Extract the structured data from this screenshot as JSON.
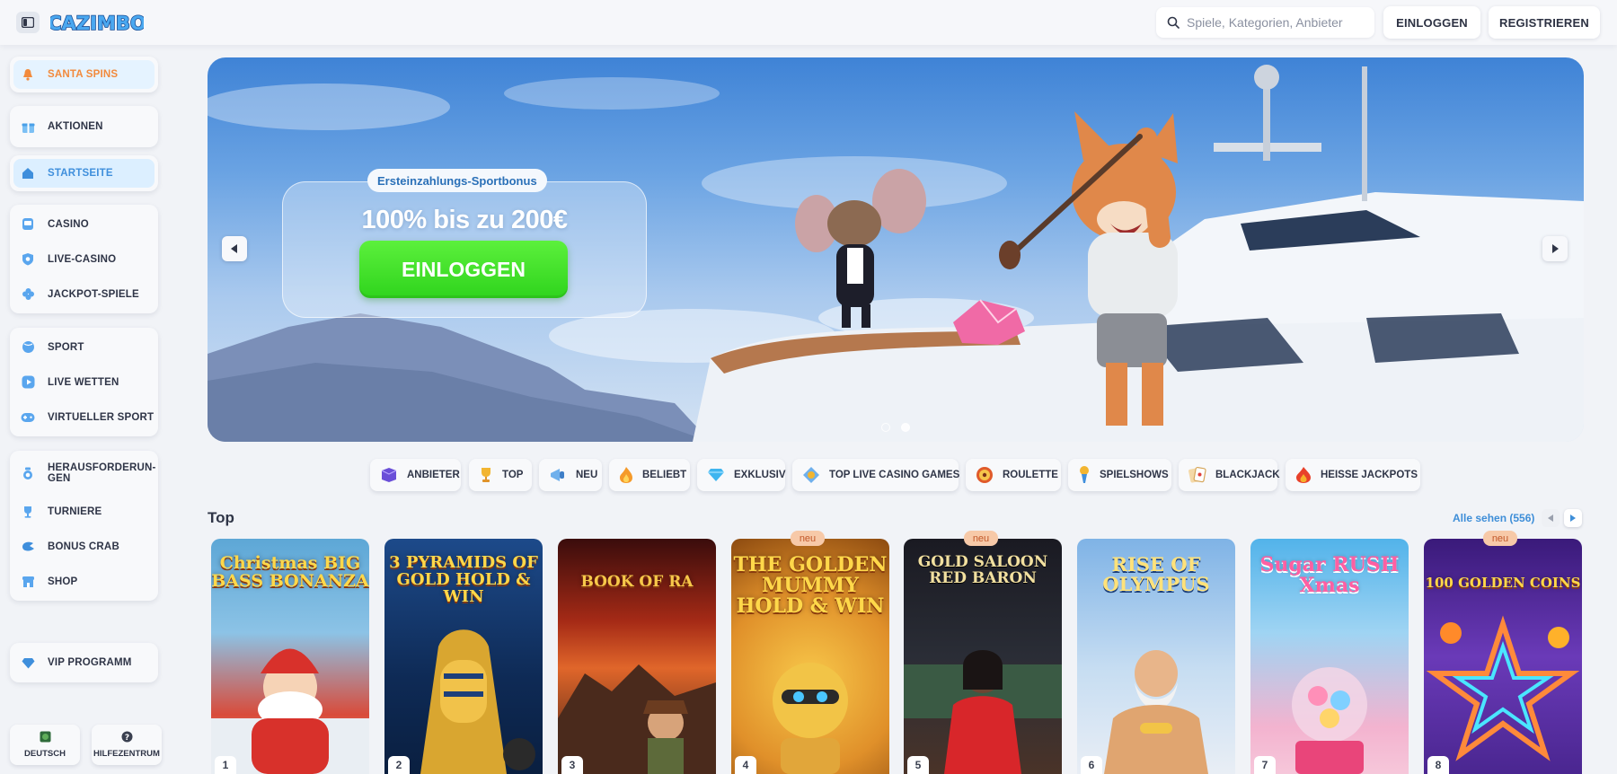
{
  "header": {
    "logo_text": "CAZIMBO",
    "search_placeholder": "Spiele, Kategorien, Anbieter",
    "login_label": "EINLOGGEN",
    "register_label": "REGISTRIEREN"
  },
  "sidebar": {
    "santa": "SANTA SPINS",
    "promotions": "AKTIONEN",
    "home": "STARTSEITE",
    "casino": "CASINO",
    "live_casino": "LIVE-CASINO",
    "jackpot": "JACKPOT-SPIELE",
    "sport": "SPORT",
    "live_bets": "LIVE WETTEN",
    "virtual_sport": "VIRTUELLER SPORT",
    "challenges": "HERAUSFORDERUN-GEN",
    "tournaments": "TURNIERE",
    "bonus_crab": "BONUS CRAB",
    "shop": "SHOP",
    "vip": "VIP PROGRAMM",
    "language": "DEUTSCH",
    "help": "HILFEZENTRUM"
  },
  "banner": {
    "tag": "Ersteinzahlungs-Sportbonus",
    "title": "100% bis zu 200€",
    "cta": "EINLOGGEN",
    "active_slide": 2,
    "slide_count": 2
  },
  "categories": [
    {
      "label": "ANBIETER",
      "icon": "provider-icon"
    },
    {
      "label": "TOP",
      "icon": "trophy-icon"
    },
    {
      "label": "NEU",
      "icon": "megaphone-icon"
    },
    {
      "label": "BELIEBT",
      "icon": "flame-icon"
    },
    {
      "label": "EXKLUSIV",
      "icon": "diamond-icon"
    },
    {
      "label": "TOP LIVE CASINO GAMES",
      "icon": "live-casino-icon"
    },
    {
      "label": "ROULETTE",
      "icon": "roulette-icon"
    },
    {
      "label": "SPIELSHOWS",
      "icon": "microphone-icon"
    },
    {
      "label": "BLACKJACK",
      "icon": "cards-icon"
    },
    {
      "label": "HEISSE JACKPOTS",
      "icon": "hot-jackpot-icon"
    }
  ],
  "top": {
    "title": "Top",
    "see_all": "Alle sehen (556)",
    "new_badge": "neu",
    "games": [
      {
        "title": "Christmas BIG BASS BONANZA",
        "rank": "1",
        "new": false
      },
      {
        "title": "3 PYRAMIDS OF GOLD HOLD & WIN",
        "rank": "2",
        "new": false
      },
      {
        "title": "BOOK OF RA",
        "rank": "3",
        "new": false
      },
      {
        "title": "THE GOLDEN MUMMY HOLD & WIN",
        "rank": "4",
        "new": true
      },
      {
        "title": "GOLD SALOON RED BARON",
        "rank": "5",
        "new": true
      },
      {
        "title": "RISE OF OLYMPUS",
        "rank": "6",
        "new": false
      },
      {
        "title": "Sugar RUSH Xmas",
        "rank": "7",
        "new": false
      },
      {
        "title": "100 GOLDEN COINS",
        "rank": "8",
        "new": true
      }
    ]
  },
  "colors": {
    "accent_blue": "#3e8ed8",
    "santa_orange": "#f28a3c",
    "cta_green": "#3cdc28",
    "badge_new": "#f7c9a8"
  }
}
